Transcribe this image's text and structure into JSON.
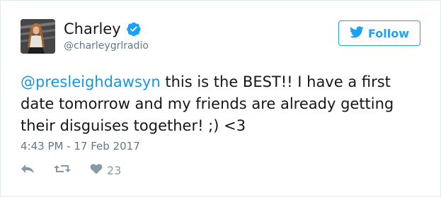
{
  "tweet": {
    "display_name": "Charley",
    "handle": "@charleygrlradio",
    "follow_label": "Follow",
    "mention": "@presleighdawsyn",
    "body": " this is the BEST!! I have a first date tomorrow and my friends are already getting their disguises together! ;) <3",
    "timestamp": "4:43 PM - 17 Feb 2017",
    "like_count": "23"
  },
  "icons": {
    "verified": "verified-badge-icon",
    "bird": "twitter-bird-icon",
    "reply": "reply-icon",
    "retweet": "retweet-icon",
    "like": "heart-icon"
  },
  "colors": {
    "accent": "#1da1f2",
    "link": "#1b95e0",
    "muted": "#657786",
    "action_gray": "#8899a6"
  }
}
